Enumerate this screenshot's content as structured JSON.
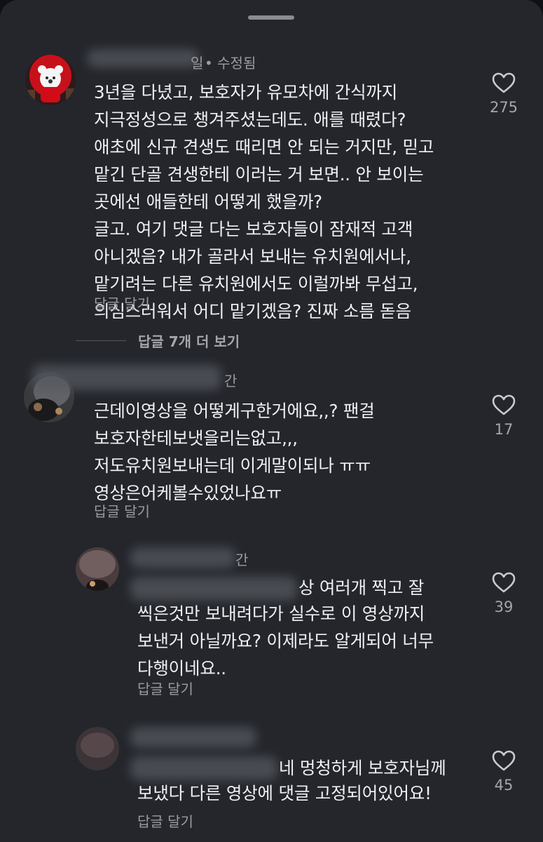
{
  "comments": [
    {
      "name_suffix": "일",
      "meta": "•  수정됨",
      "body": "3년을 다녔고, 보호자가 유모차에 간식까지\n지극정성으로 챙겨주셨는데도. 애를 때렸다?\n애초에 신규 견생도 때리면 안 되는 거지만, 믿고\n맡긴 단골 견생한테 이러는 거 보면.. 안 보이는\n곳에선 애들한테 어떻게 했을까?\n글고. 여기 댓글 다는 보호자들이 잠재적 고객\n아니겠음? 내가 골라서 보내는 유치원에서나,\n맡기려는 다른 유치원에서도 이럴까봐 무섭고,\n의심스러워서 어디 맡기겠음? 진짜 소름 돋음",
      "reply": "답글 달기",
      "likes": "275"
    },
    {
      "name_suffix": "간",
      "body": "근데이영상을 어떻게구한거에요,,? 팬걸\n보호자한테보냇을리는없고,,,\n저도유치원보내는데 이게말이되나 ㅠㅠ\n영상은어케볼수있었나요ㅠ",
      "reply": "답글 달기",
      "likes": "17"
    },
    {
      "name_suffix": "간",
      "body_partial": "상 여러개 찍고 잘",
      "body": "씩은것만 보내려다가 실수로 이 영상까지\n보낸거 아닐까요? 이제라도 알게되어 너무\n다행이네요..",
      "reply": "답글 달기",
      "likes": "39"
    },
    {
      "body_partial": "네 멍청하게 보호자님께",
      "body": "보냈다 다른 영상에  댓글 고정되어있어요!",
      "reply": "답글 달기",
      "likes": "45"
    }
  ],
  "more_replies": "답글 7개 더 보기",
  "icons": {
    "like": "heart-outline-icon"
  },
  "colors": {
    "background": "#24262c",
    "text": "#f0f0f2",
    "muted": "#9a9ca2"
  }
}
